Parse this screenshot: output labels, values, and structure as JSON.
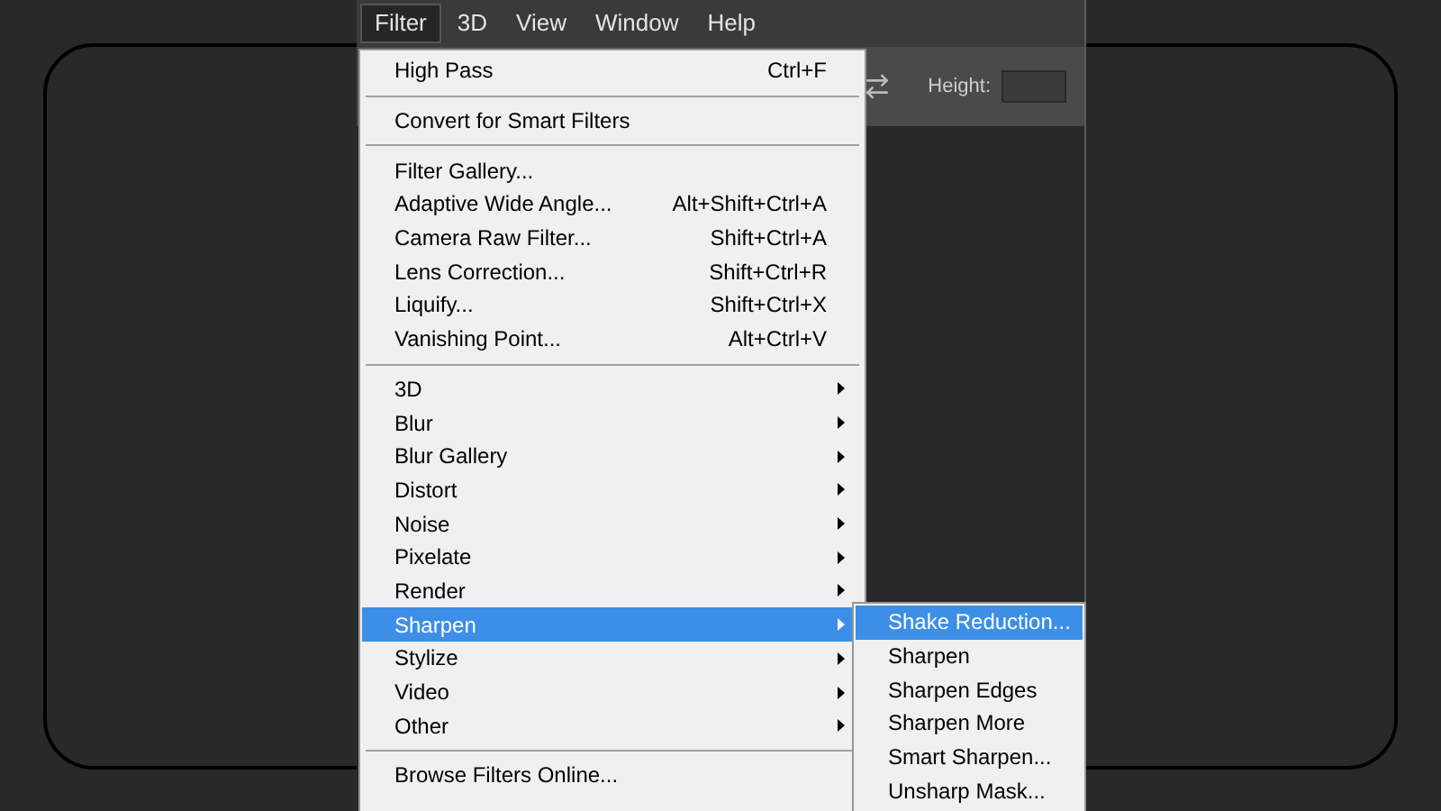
{
  "menubar": [
    {
      "label": "Filter",
      "selected": true
    },
    {
      "label": "3D",
      "selected": false
    },
    {
      "label": "View",
      "selected": false
    },
    {
      "label": "Window",
      "selected": false
    },
    {
      "label": "Help",
      "selected": false
    }
  ],
  "options_bar": {
    "height_label": "Height:"
  },
  "filter_menu": {
    "sections": [
      [
        {
          "label": "High Pass",
          "shortcut": "Ctrl+F",
          "submenu": false,
          "selected": false
        }
      ],
      [
        {
          "label": "Convert for Smart Filters",
          "submenu": false,
          "selected": false
        }
      ],
      [
        {
          "label": "Filter Gallery...",
          "submenu": false,
          "selected": false
        },
        {
          "label": "Adaptive Wide Angle...",
          "shortcut": "Alt+Shift+Ctrl+A",
          "submenu": false,
          "selected": false
        },
        {
          "label": "Camera Raw Filter...",
          "shortcut": "Shift+Ctrl+A",
          "submenu": false,
          "selected": false
        },
        {
          "label": "Lens Correction...",
          "shortcut": "Shift+Ctrl+R",
          "submenu": false,
          "selected": false
        },
        {
          "label": "Liquify...",
          "shortcut": "Shift+Ctrl+X",
          "submenu": false,
          "selected": false
        },
        {
          "label": "Vanishing Point...",
          "shortcut": "Alt+Ctrl+V",
          "submenu": false,
          "selected": false
        }
      ],
      [
        {
          "label": "3D",
          "submenu": true,
          "selected": false
        },
        {
          "label": "Blur",
          "submenu": true,
          "selected": false
        },
        {
          "label": "Blur Gallery",
          "submenu": true,
          "selected": false
        },
        {
          "label": "Distort",
          "submenu": true,
          "selected": false
        },
        {
          "label": "Noise",
          "submenu": true,
          "selected": false
        },
        {
          "label": "Pixelate",
          "submenu": true,
          "selected": false
        },
        {
          "label": "Render",
          "submenu": true,
          "selected": false
        },
        {
          "label": "Sharpen",
          "submenu": true,
          "selected": true
        },
        {
          "label": "Stylize",
          "submenu": true,
          "selected": false
        },
        {
          "label": "Video",
          "submenu": true,
          "selected": false
        },
        {
          "label": "Other",
          "submenu": true,
          "selected": false
        }
      ],
      [
        {
          "label": "Browse Filters Online...",
          "submenu": false,
          "selected": false
        }
      ]
    ]
  },
  "sharpen_submenu": [
    {
      "label": "Shake Reduction...",
      "selected": true
    },
    {
      "label": "Sharpen",
      "selected": false
    },
    {
      "label": "Sharpen Edges",
      "selected": false
    },
    {
      "label": "Sharpen More",
      "selected": false
    },
    {
      "label": "Smart Sharpen...",
      "selected": false
    },
    {
      "label": "Unsharp Mask...",
      "selected": false
    }
  ]
}
